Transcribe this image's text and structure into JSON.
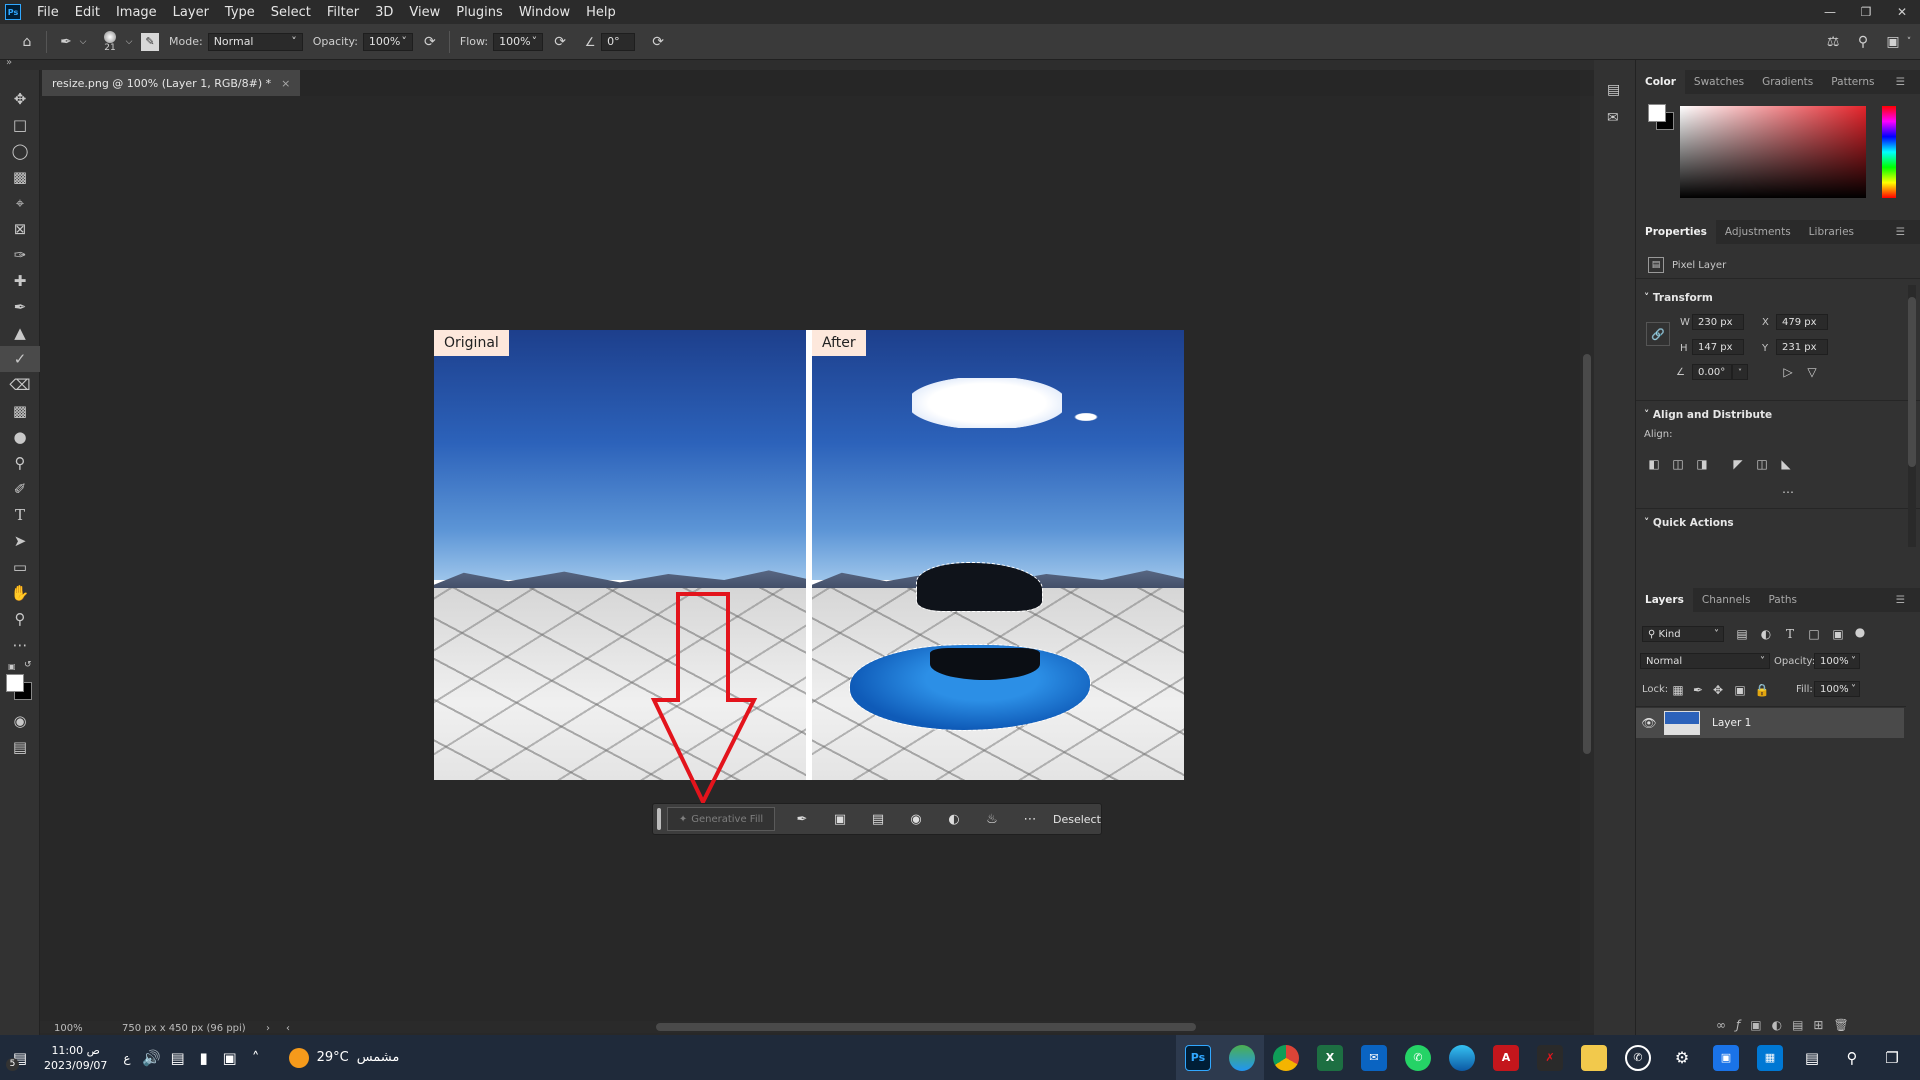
{
  "app": {
    "logo": "Ps"
  },
  "menu": [
    "File",
    "Edit",
    "Image",
    "Layer",
    "Type",
    "Select",
    "Filter",
    "3D",
    "View",
    "Plugins",
    "Window",
    "Help"
  ],
  "options_bar": {
    "brush_size": "21",
    "mode_label": "Mode:",
    "mode_value": "Normal",
    "opacity_label": "Opacity:",
    "opacity_value": "100%",
    "flow_label": "Flow:",
    "flow_value": "100%",
    "angle_value": "0°"
  },
  "document": {
    "tab_title": "resize.png @ 100% (Layer 1, RGB/8#) *",
    "zoom": "100%",
    "dimensions": "750 px x 450 px (96 ppi)",
    "label_original": "Original",
    "label_after": "After"
  },
  "contextual_bar": {
    "generative_fill": "Generative Fill",
    "deselect": "Deselect"
  },
  "color_panel": {
    "tabs": [
      "Color",
      "Swatches",
      "Gradients",
      "Patterns"
    ]
  },
  "properties_panel": {
    "tabs": [
      "Properties",
      "Adjustments",
      "Libraries"
    ],
    "layer_type": "Pixel Layer",
    "transform_title": "Transform",
    "w_label": "W",
    "w_value": "230 px",
    "h_label": "H",
    "h_value": "147 px",
    "x_label": "X",
    "x_value": "479 px",
    "y_label": "Y",
    "y_value": "231 px",
    "angle_value": "0.00°",
    "align_title": "Align and Distribute",
    "align_label": "Align:",
    "quick_actions_title": "Quick Actions"
  },
  "layers_panel": {
    "tabs": [
      "Layers",
      "Channels",
      "Paths"
    ],
    "filter_kind": "Kind",
    "blend_mode": "Normal",
    "opacity_label": "Opacity:",
    "opacity_value": "100%",
    "lock_label": "Lock:",
    "fill_label": "Fill:",
    "fill_value": "100%",
    "layer_name": "Layer 1"
  },
  "taskbar": {
    "time": "11:00 ص",
    "date": "2023/09/07",
    "lang": "ع",
    "weather_temp": "29°C",
    "weather_text": "مشمس",
    "notif_count": "5"
  },
  "colors": {
    "accent": "#31a8ff",
    "arrow": "#e3141c"
  }
}
